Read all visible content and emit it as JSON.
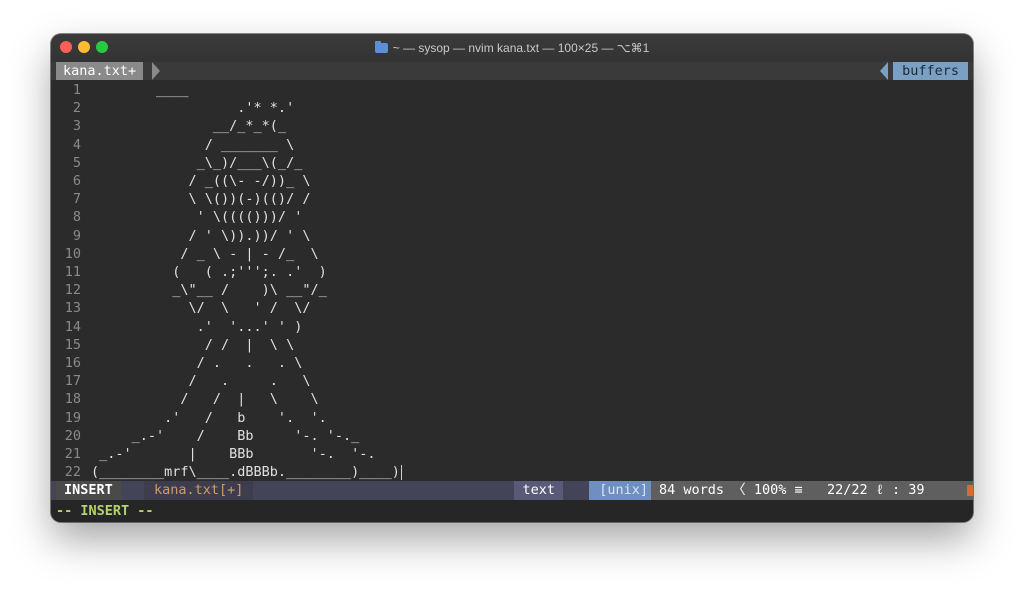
{
  "window": {
    "title": "~ — sysop — nvim kana.txt — 100×25 — ⌥⌘1"
  },
  "tabline": {
    "active_tab": "kana.txt+",
    "right_label": "buffers"
  },
  "editor": {
    "lines": [
      {
        "n": "1",
        "text": "        ____"
      },
      {
        "n": "2",
        "text": "                  .'* *.'"
      },
      {
        "n": "3",
        "text": "               __/_*_*(_"
      },
      {
        "n": "4",
        "text": "              / _______ \\"
      },
      {
        "n": "5",
        "text": "             _\\_)/___\\(_/_"
      },
      {
        "n": "6",
        "text": "            / _((\\- -/))_ \\"
      },
      {
        "n": "7",
        "text": "            \\ \\())(-)(()/ /"
      },
      {
        "n": "8",
        "text": "             ' \\(((()))/ '"
      },
      {
        "n": "9",
        "text": "            / ' \\)).))/ ' \\"
      },
      {
        "n": "10",
        "text": "           / _ \\ - | - /_  \\"
      },
      {
        "n": "11",
        "text": "          (   ( .;''';. .'  )"
      },
      {
        "n": "12",
        "text": "          _\\\"__ /    )\\ __\"/_"
      },
      {
        "n": "13",
        "text": "            \\/  \\   ' /  \\/"
      },
      {
        "n": "14",
        "text": "             .'  '...' ' )"
      },
      {
        "n": "15",
        "text": "              / /  |  \\ \\"
      },
      {
        "n": "16",
        "text": "             / .   .   . \\"
      },
      {
        "n": "17",
        "text": "            /   .     .   \\"
      },
      {
        "n": "18",
        "text": "           /   /  |   \\    \\"
      },
      {
        "n": "19",
        "text": "         .'   /   b    '.  '."
      },
      {
        "n": "20",
        "text": "     _.-'    /    Bb     '-. '-._"
      },
      {
        "n": "21",
        "text": " _.-'       |    BBb       '-.  '-."
      },
      {
        "n": "22",
        "text": "(________mrf\\____.dBBBb.________)____)"
      }
    ]
  },
  "statusline": {
    "mode": "INSERT",
    "filename": "kana.txt[+]",
    "filetype": "text",
    "fileformat": "[unix]",
    "words": "84 words",
    "percent": "100%",
    "position": "22/22",
    "column": "39"
  },
  "cmdline": {
    "text": "-- INSERT --"
  },
  "colors": {
    "background": "#2b2b2b",
    "insert_mode_msg": "#b5d36a",
    "filename_modified": "#d19a66",
    "fileformat_bg": "#6e8fc0",
    "buffers_bg": "#7aa0c4"
  }
}
